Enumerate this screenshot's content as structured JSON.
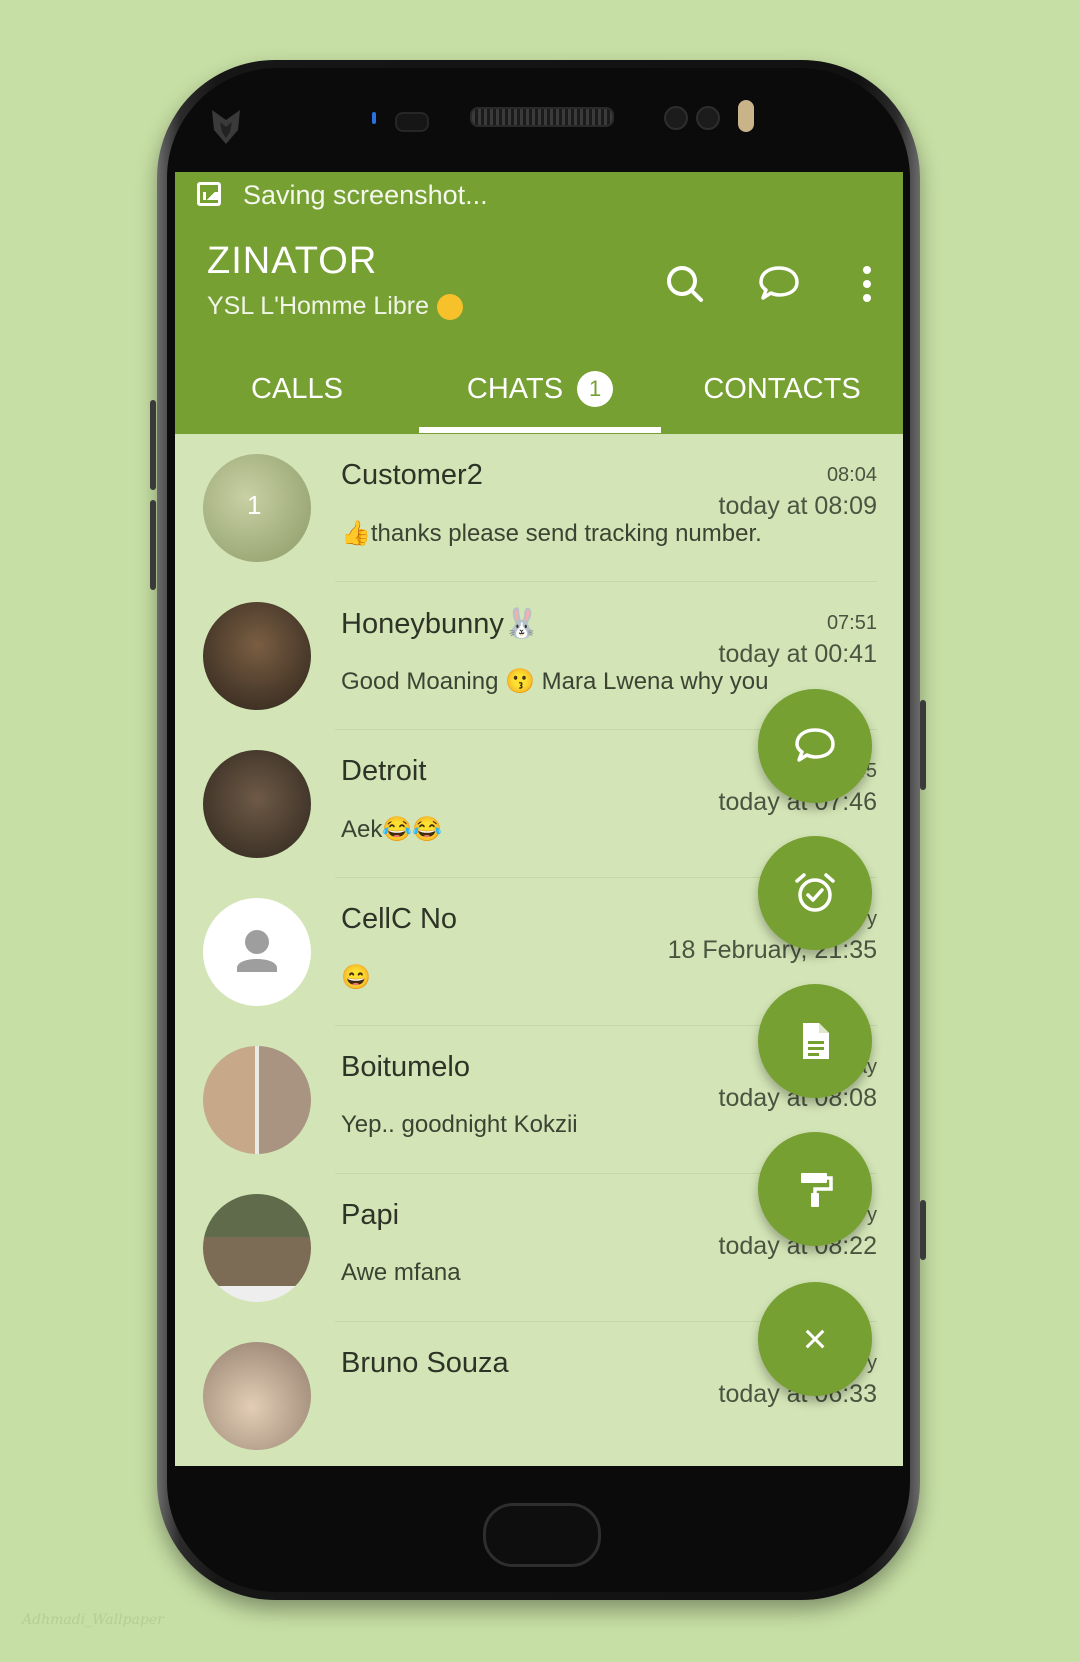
{
  "status_bar": {
    "notification": "Saving screenshot..."
  },
  "header": {
    "title": "ZINATOR",
    "subtitle": "YSL L'Homme Libre"
  },
  "tabs": [
    {
      "label": "CALLS"
    },
    {
      "label": "CHATS",
      "badge": "1",
      "selected": true
    },
    {
      "label": "CONTACTS"
    }
  ],
  "chats": [
    {
      "name": "Customer2",
      "time_small": "08:04",
      "time": "today at 08:09",
      "message": "👍thanks please send tracking number.",
      "avatar_badge": "1",
      "avatar_color": "#9aa77a"
    },
    {
      "name": "Honeybunny🐰",
      "time_small": "07:51",
      "time": "today at 00:41",
      "message": "Good Moaning 😗 Mara Lwena why you",
      "avatar_color": "#4e3f2f"
    },
    {
      "name": "Detroit",
      "time_small": ":45",
      "time": "today at 07:46",
      "message": "Aek😂😂",
      "avatar_color": "#5a4b3a"
    },
    {
      "name": "CellC No",
      "time_small": "y",
      "time": "18 February, 21:35",
      "message": "😄",
      "avatar_color": "#ffffff"
    },
    {
      "name": "Boitumelo",
      "time_small": "ay",
      "time": "today at 08:08",
      "message": "Yep.. goodnight Kokzii",
      "avatar_color": "#b7a48e"
    },
    {
      "name": "Papi",
      "time_small": "y",
      "time": "today at 08:22",
      "message": "Awe mfana",
      "avatar_color": "#6b6b55"
    },
    {
      "name": "Bruno Souza",
      "time_small": "y",
      "time": "today at 06:33",
      "message": "",
      "avatar_color": "#c9b7a5"
    }
  ],
  "fab_menu": {
    "items": [
      "chat-bubble-icon",
      "alarm-check-icon",
      "document-icon",
      "paint-roller-icon"
    ],
    "close": "×"
  },
  "colors": {
    "accent": "#76a032",
    "background": "#c6dfa4",
    "list_bg": "#d3e5b6"
  }
}
